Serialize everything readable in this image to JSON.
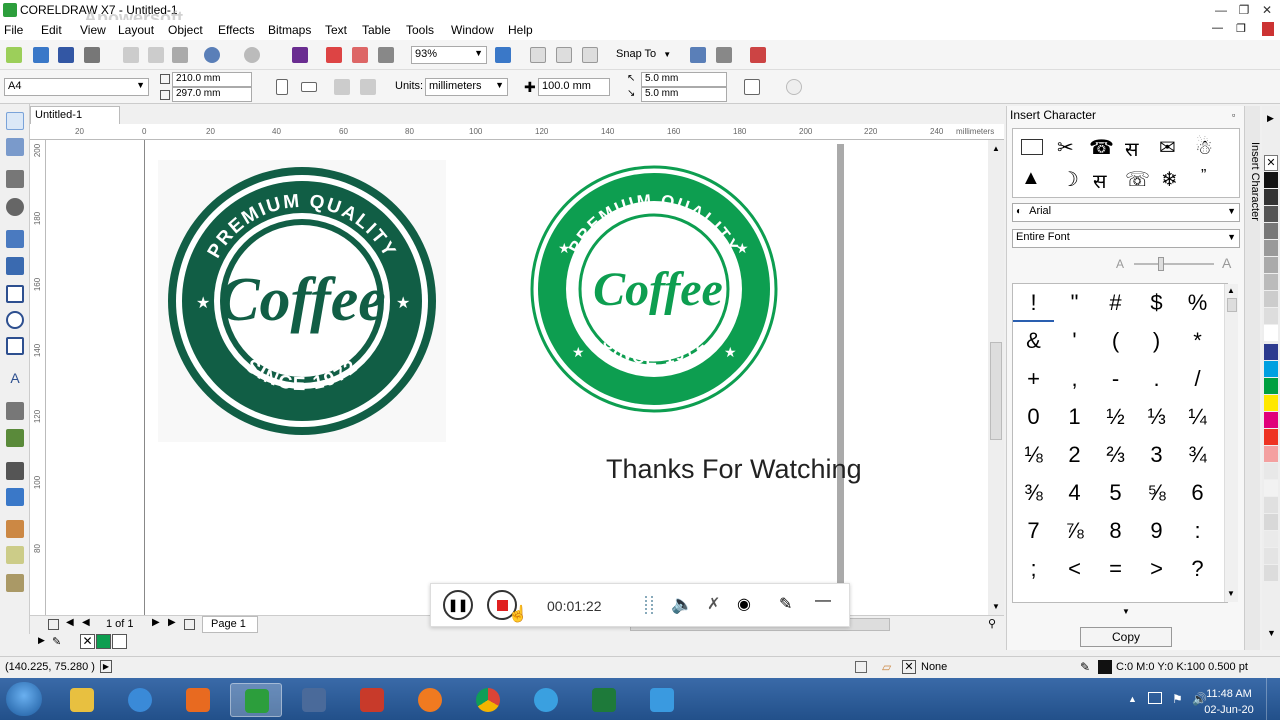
{
  "window": {
    "title": "CORELDRAW X7 - Untitled-1",
    "watermark_line1": "Apowersoft",
    "watermark_line2": "Screen Recorder Pro"
  },
  "menubar": {
    "items": [
      "File",
      "Edit",
      "View",
      "Layout",
      "Object",
      "Effects",
      "Bitmaps",
      "Text",
      "Table",
      "Tools",
      "Window",
      "Help"
    ]
  },
  "toolbar1": {
    "zoom": "93%",
    "snap_to": "Snap To"
  },
  "toolbar2": {
    "page_size": "A4",
    "width": "210.0 mm",
    "height": "297.0 mm",
    "units_label": "Units:",
    "units_value": "millimeters",
    "nudge": "100.0 mm",
    "dup_x": "5.0 mm",
    "dup_y": "5.0 mm"
  },
  "document": {
    "tab_label": "Untitled-1",
    "ruler_unit": "millimeters",
    "hruler_ticks": [
      "20",
      "0",
      "20",
      "40",
      "60",
      "80",
      "100",
      "120",
      "140",
      "160",
      "180",
      "200",
      "220",
      "240"
    ],
    "vruler_ticks": [
      "200",
      "180",
      "160",
      "140",
      "120",
      "100",
      "80"
    ]
  },
  "canvas": {
    "logo_top_text": "PREMIUM QUALITY",
    "logo_center_text": "Coffee",
    "logo_bottom_text": "SINCE 1972",
    "caption": "Thanks For Watching",
    "dark_green": "#115e45",
    "light_green": "#0d9e50"
  },
  "pagenav": {
    "page_count": "1 of 1",
    "page_tab": "Page 1"
  },
  "docker": {
    "title": "Insert Character",
    "side_tab": "Insert Character",
    "font": "Arial",
    "range": "Entire Font",
    "copy_button": "Copy",
    "glyphs": [
      "!",
      "\"",
      "#",
      "$",
      "%",
      "&",
      "'",
      "(",
      ")",
      "*",
      "+",
      ",",
      "-",
      ".",
      "/",
      "0",
      "1",
      "½",
      "⅓",
      "¼",
      "⅛",
      "2",
      "⅔",
      "3",
      "¾",
      "⅜",
      "4",
      "5",
      "⅝",
      "6",
      "7",
      "⅞",
      "8",
      "9",
      ":",
      ";",
      "<",
      "=",
      ">",
      "?"
    ]
  },
  "recorder": {
    "time": "00:01:22"
  },
  "statusbar": {
    "coords": "(140.225, 75.280 )",
    "fill_none": "None",
    "outline": "C:0 M:0 Y:0 K:100  0.500 pt"
  },
  "taskbar": {
    "time": "11:48 AM",
    "date": "02-Jun-20"
  }
}
